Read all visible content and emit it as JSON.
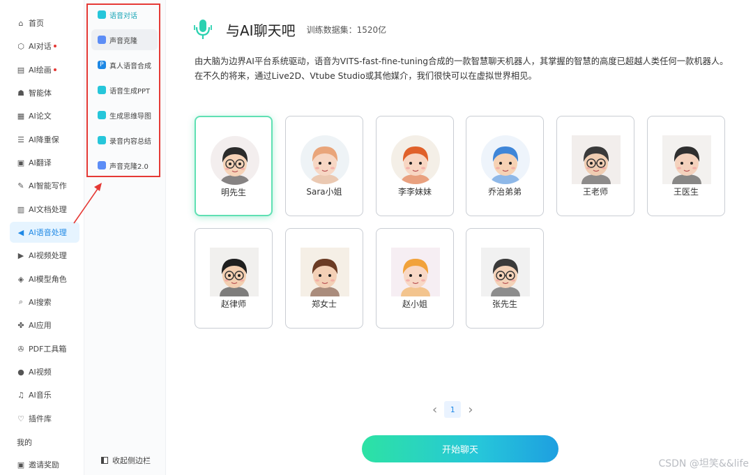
{
  "sidebar": {
    "items": [
      {
        "label": "首页",
        "icon": "home-icon",
        "glyph": "⌂",
        "dot": false
      },
      {
        "label": "AI对话",
        "icon": "cube-icon",
        "glyph": "⬡",
        "dot": true
      },
      {
        "label": "AI绘画",
        "icon": "image-icon",
        "glyph": "▤",
        "dot": true
      },
      {
        "label": "智能体",
        "icon": "robot-icon",
        "glyph": "☗",
        "dot": false
      },
      {
        "label": "AI论文",
        "icon": "document-icon",
        "glyph": "▦",
        "dot": false
      },
      {
        "label": "AI降重保",
        "icon": "list-icon",
        "glyph": "☰",
        "dot": false
      },
      {
        "label": "AI翻译",
        "icon": "translate-icon",
        "glyph": "▣",
        "dot": false
      },
      {
        "label": "AI智能写作",
        "icon": "pen-icon",
        "glyph": "✎",
        "dot": false
      },
      {
        "label": "AI文档处理",
        "icon": "doc-process-icon",
        "glyph": "▥",
        "dot": false
      },
      {
        "label": "AI语音处理",
        "icon": "speaker-icon",
        "glyph": "◀",
        "dot": false,
        "active": true
      },
      {
        "label": "AI视频处理",
        "icon": "video-icon",
        "glyph": "▶",
        "dot": false
      },
      {
        "label": "AI模型角色",
        "icon": "model-icon",
        "glyph": "◈",
        "dot": false
      },
      {
        "label": "AI搜索",
        "icon": "search-icon",
        "glyph": "⌕",
        "dot": false
      },
      {
        "label": "AI应用",
        "icon": "apps-icon",
        "glyph": "✤",
        "dot": false
      },
      {
        "label": "PDF工具箱",
        "icon": "wrench-icon",
        "glyph": "✇",
        "dot": false
      },
      {
        "label": "AI视频",
        "icon": "play-circle-icon",
        "glyph": "●",
        "dot": false
      },
      {
        "label": "AI音乐",
        "icon": "music-icon",
        "glyph": "♫",
        "dot": false
      },
      {
        "label": "插件库",
        "icon": "bulb-icon",
        "glyph": "♡",
        "dot": false
      }
    ],
    "section_label": "我的",
    "invite_label": "邀请奖励"
  },
  "subnav": {
    "items": [
      {
        "label": "语音对话",
        "icon": "voice-chat-icon",
        "color": "#26c6da",
        "active": true
      },
      {
        "label": "声音克隆",
        "icon": "voice-clone-icon",
        "color": "#5c8df6",
        "hover": true
      },
      {
        "label": "真人语音合成",
        "icon": "p-badge-icon",
        "color": "#1e88e5",
        "glyph": "P"
      },
      {
        "label": "语音生成PPT",
        "icon": "ppt-icon",
        "color": "#26c6da"
      },
      {
        "label": "生成思维导图",
        "icon": "mindmap-icon",
        "color": "#26c6da"
      },
      {
        "label": "录音内容总结",
        "icon": "record-icon",
        "color": "#26c6da"
      },
      {
        "label": "声音克隆2.0",
        "icon": "voice-clone2-icon",
        "color": "#5c8df6"
      }
    ],
    "collapse_label": "收起侧边栏"
  },
  "main": {
    "title": "与AI聊天吧",
    "train_label": "训练数据集：1520亿",
    "description": "由大脑为边界AI平台系统驱动，语音为VITS-fast-fine-tuning合成的一款智慧聊天机器人，其掌握的智慧的高度已超越人类任何一款机器人。在不久的将来，通过Live2D、Vtube Studio或其他媒介，我们很快可以在虚拟世界相见。",
    "characters": [
      {
        "name": "明先生",
        "selected": true,
        "skin": "#f6d3b8",
        "hair": "#2b2b2b",
        "bg": "#f3eeee",
        "glasses": true
      },
      {
        "name": "Sara小姐",
        "skin": "#f7d7c4",
        "hair": "#e9a57a",
        "bg": "#eef3f6"
      },
      {
        "name": "李李妹妹",
        "skin": "#f8d6c2",
        "hair": "#e0612a",
        "bg": "#f4efe7"
      },
      {
        "name": "乔治弟弟",
        "skin": "#f6d2b4",
        "hair": "#3f86d8",
        "bg": "#eef4fb"
      },
      {
        "name": "王老师",
        "skin": "#f0cdb2",
        "hair": "#3a3a3a",
        "bg": "#f2eeec",
        "glasses": true,
        "square": true
      },
      {
        "name": "王医生",
        "skin": "#f4d2bd",
        "hair": "#2f2f2f",
        "bg": "#f3f1ef",
        "square": true
      },
      {
        "name": "赵律师",
        "skin": "#f3cfb1",
        "hair": "#1f1f1f",
        "bg": "#f1f0ee",
        "glasses": true,
        "square": true
      },
      {
        "name": "郑女士",
        "skin": "#f3d0b6",
        "hair": "#6b3b24",
        "bg": "#f5efe6",
        "square": true
      },
      {
        "name": "赵小姐",
        "skin": "#f8d8c6",
        "hair": "#f1a23b",
        "bg": "#f6eef3",
        "square": true
      },
      {
        "name": "张先生",
        "skin": "#f4d2b8",
        "hair": "#3a3a3a",
        "bg": "#f1f1f1",
        "glasses": true,
        "square": true
      }
    ],
    "pager": {
      "page": "1",
      "prev": "‹",
      "next": "›"
    },
    "start_label": "开始聊天"
  },
  "watermark": "CSDN @坦笑&&life",
  "colors": {
    "accent": "#26c6da",
    "active_bg": "#e6f4ff",
    "annotation": "#e53935"
  }
}
